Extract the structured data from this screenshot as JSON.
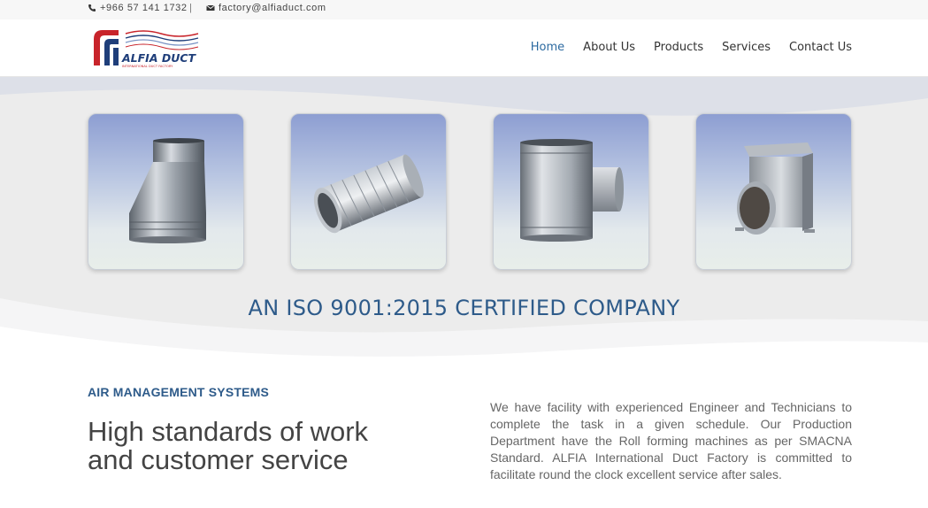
{
  "topbar": {
    "phone": "+966 57 141 1732",
    "separator": "|",
    "email": "factory@alfiaduct.com"
  },
  "logo": {
    "name": "ALFIA DUCT",
    "tagline": "INTERNATIONAL DUCT FACTORY",
    "colors": {
      "red": "#c8242b",
      "blue": "#1f3e7a"
    }
  },
  "nav": {
    "items": [
      {
        "label": "Home",
        "active": true
      },
      {
        "label": "About Us",
        "active": false
      },
      {
        "label": "Products",
        "active": false
      },
      {
        "label": "Services",
        "active": false
      },
      {
        "label": "Contact Us",
        "active": false
      }
    ]
  },
  "hero": {
    "products": [
      {
        "name": "duct-reducer"
      },
      {
        "name": "spiral-silencer"
      },
      {
        "name": "tee-fitting"
      },
      {
        "name": "plenum-box"
      }
    ],
    "headline": "AN ISO 9001:2015 CERTIFIED COMPANY"
  },
  "about": {
    "kicker": "AIR MANAGEMENT SYSTEMS",
    "title": "High standards of work and customer service",
    "body": "We have facility with experienced Engineer and Technicians to complete the task in a given schedule. Our Production Department have the Roll forming machines as per SMACNA Standard. ALFIA International Duct Factory is committed to facilitate round the clock excellent service after sales."
  },
  "colors": {
    "accent": "#2c6aa0",
    "heading_blue": "#2e5b8a"
  }
}
